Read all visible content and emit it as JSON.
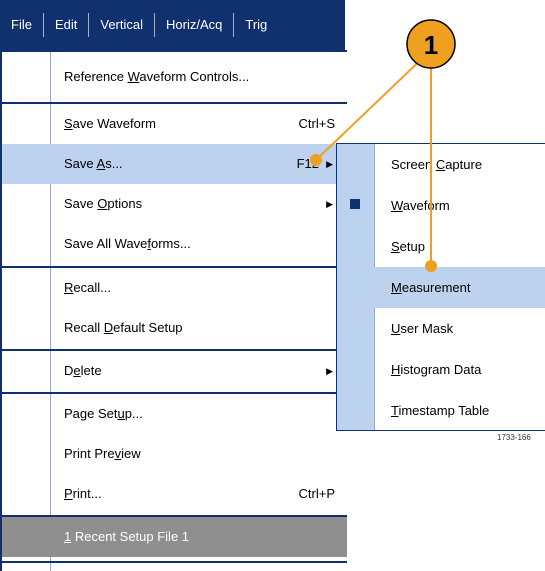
{
  "menubar": {
    "items": [
      "File",
      "Edit",
      "Vertical",
      "Horiz/Acq",
      "Trig"
    ]
  },
  "menu": {
    "items": [
      {
        "label_pre": "Reference ",
        "label_u": "W",
        "label_post": "aveform Controls...",
        "shortcut": ""
      },
      {
        "label_pre": "",
        "label_u": "S",
        "label_post": "ave Waveform",
        "shortcut": "Ctrl+S"
      },
      {
        "label_pre": "Save ",
        "label_u": "A",
        "label_post": "s...",
        "shortcut": "F12"
      },
      {
        "label_pre": "Save ",
        "label_u": "O",
        "label_post": "ptions",
        "shortcut": ""
      },
      {
        "label_pre": "Save All Wave",
        "label_u": "f",
        "label_post": "orms...",
        "shortcut": ""
      },
      {
        "label_pre": "",
        "label_u": "R",
        "label_post": "ecall...",
        "shortcut": ""
      },
      {
        "label_pre": "Recall ",
        "label_u": "D",
        "label_post": "efault Setup",
        "shortcut": ""
      },
      {
        "label_pre": "D",
        "label_u": "e",
        "label_post": "lete",
        "shortcut": ""
      },
      {
        "label_pre": "Page Set",
        "label_u": "u",
        "label_post": "p...",
        "shortcut": ""
      },
      {
        "label_pre": "Print Pre",
        "label_u": "v",
        "label_post": "iew",
        "shortcut": ""
      },
      {
        "label_pre": "",
        "label_u": "P",
        "label_post": "rint...",
        "shortcut": "Ctrl+P"
      },
      {
        "label_pre": "",
        "label_u": "1",
        "label_post": " Recent Setup File 1",
        "shortcut": ""
      }
    ]
  },
  "submenu": {
    "items": [
      {
        "label_pre": "Screen ",
        "label_u": "C",
        "label_post": "apture"
      },
      {
        "label_pre": "",
        "label_u": "W",
        "label_post": "aveform"
      },
      {
        "label_pre": "",
        "label_u": "S",
        "label_post": "etup"
      },
      {
        "label_pre": "",
        "label_u": "M",
        "label_post": "easurement"
      },
      {
        "label_pre": "",
        "label_u": "U",
        "label_post": "ser Mask"
      },
      {
        "label_pre": "",
        "label_u": "H",
        "label_post": "istogram Data"
      },
      {
        "label_pre": "",
        "label_u": "T",
        "label_post": "imestamp Table"
      }
    ]
  },
  "callout": {
    "number": "1"
  },
  "figure_ref": "1733-166",
  "colors": {
    "menubar_bg": "#10306e",
    "highlight": "#bcd2ef",
    "callout_fill": "#f0a020",
    "recent_file_bg": "#8f8f8f"
  },
  "icons": {
    "submenu_arrow": "triangle-right-icon",
    "selected_bullet": "square-bullet-icon"
  }
}
